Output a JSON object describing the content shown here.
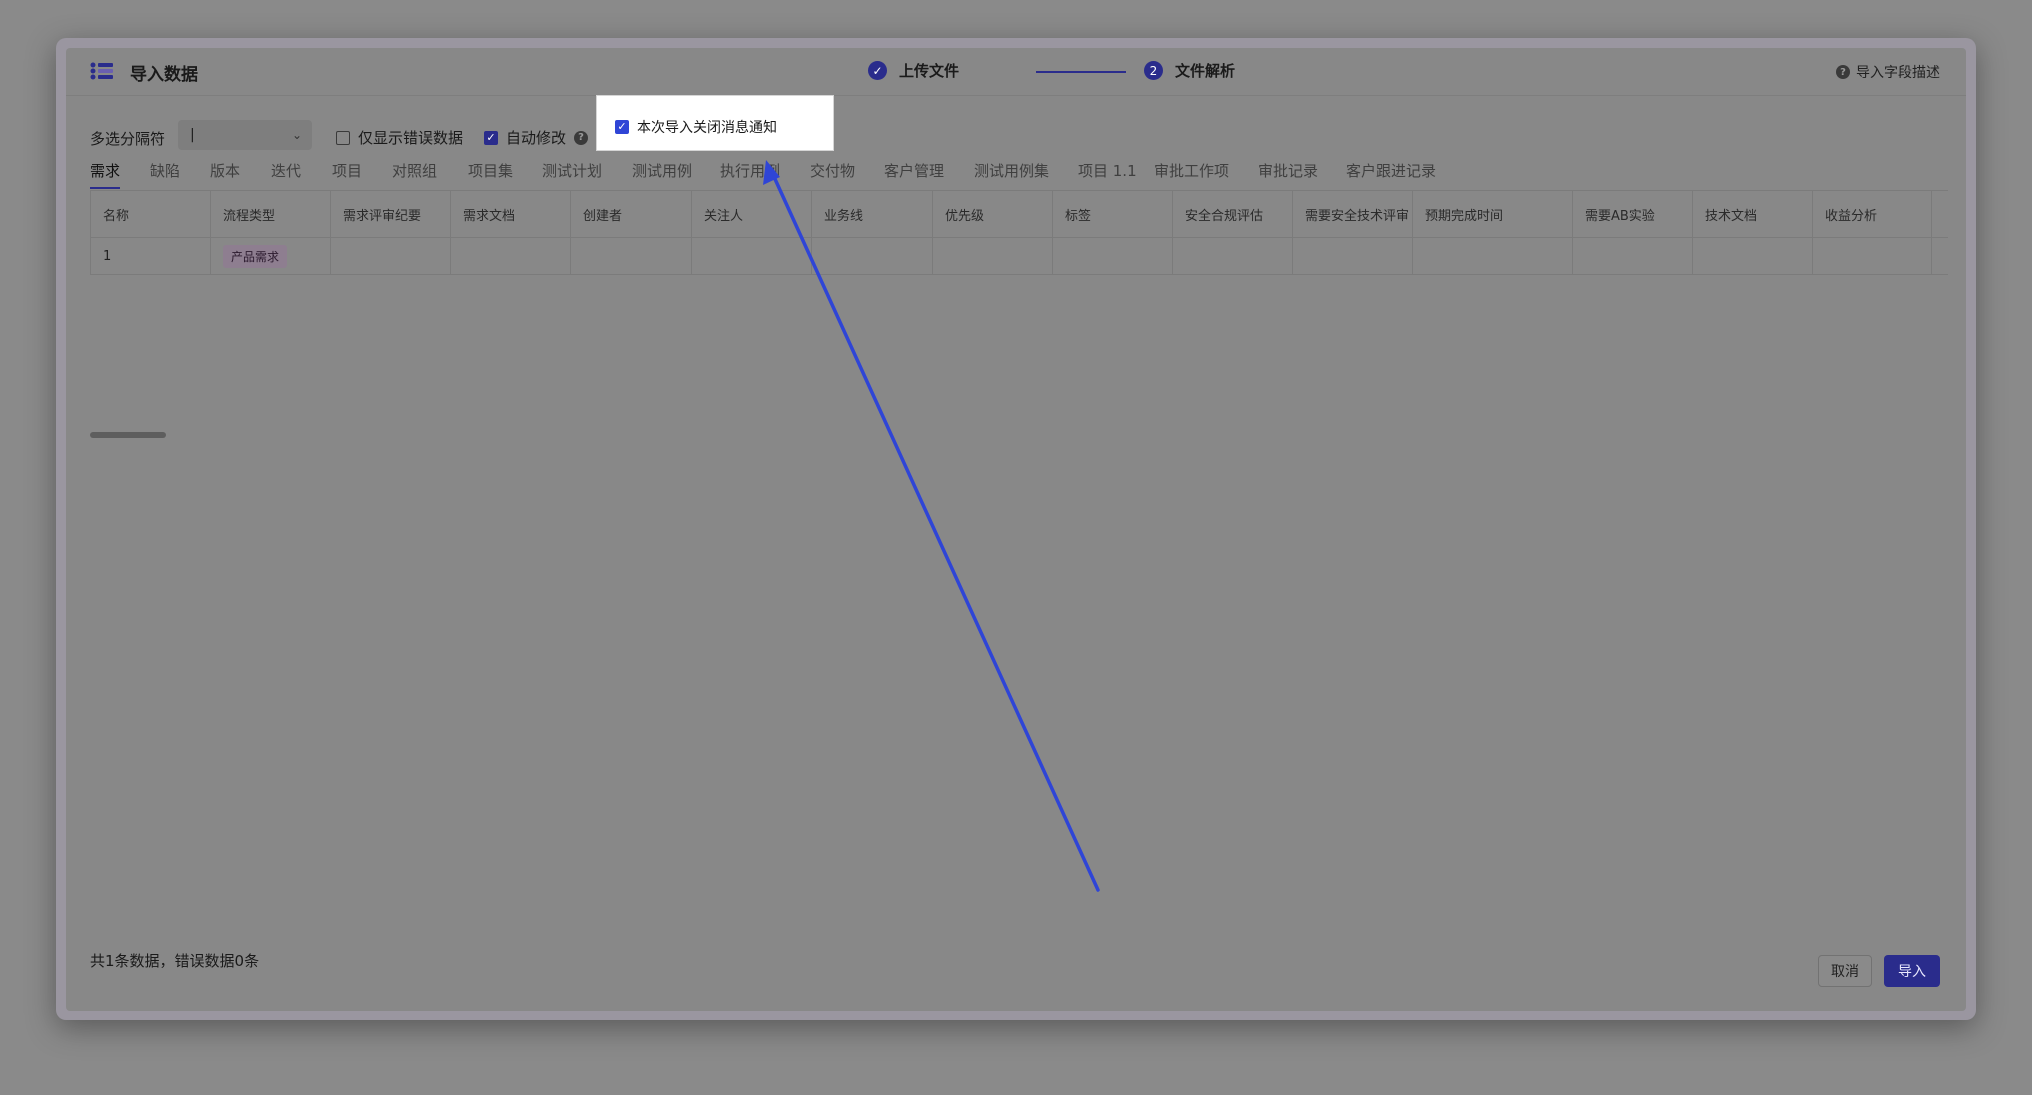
{
  "dialog": {
    "title": "导入数据",
    "field_description_link": "导入字段描述",
    "help_glyph": "?"
  },
  "steps": [
    {
      "icon": "✓",
      "label": "上传文件",
      "state": "done"
    },
    {
      "icon": "2",
      "label": "文件解析",
      "state": "current"
    }
  ],
  "toolbar": {
    "separator_label": "多选分隔符",
    "separator_value": "|",
    "separator_chevron": "⌄",
    "only_errors_label": "仅显示错误数据",
    "only_errors_checked": false,
    "auto_fix_label": "自动修改",
    "auto_fix_checked": true,
    "check_glyph": "✓"
  },
  "tabs": [
    "需求",
    "缺陷",
    "版本",
    "迭代",
    "项目",
    "对照组",
    "项目集",
    "测试计划",
    "测试用例",
    "执行用例",
    "交付物",
    "客户管理",
    "测试用例集",
    "项目 1.1",
    "审批工作项",
    "审批记录",
    "客户跟进记录"
  ],
  "active_tab": "需求",
  "table": {
    "columns": [
      "名称",
      "流程类型",
      "需求评审纪要",
      "需求文档",
      "创建者",
      "关注人",
      "业务线",
      "优先级",
      "标签",
      "安全合规评估",
      "需要安全技术评审",
      "预期完成时间",
      "需要AB实验",
      "技术文档",
      "收益分析"
    ],
    "rows": [
      [
        "1",
        "产品需求",
        "",
        "",
        "",
        "",
        "",
        "",
        "",
        "",
        "",
        "",
        "",
        "",
        ""
      ]
    ]
  },
  "footer": {
    "summary": "共1条数据，错误数据0条",
    "cancel_label": "取消",
    "import_label": "导入"
  },
  "popup": {
    "label": "本次导入关闭消息通知",
    "checked": true
  },
  "colors": {
    "accent": "#2a2c8c",
    "arrow": "#2f45d6",
    "tag_bg": "#8e7e90"
  }
}
